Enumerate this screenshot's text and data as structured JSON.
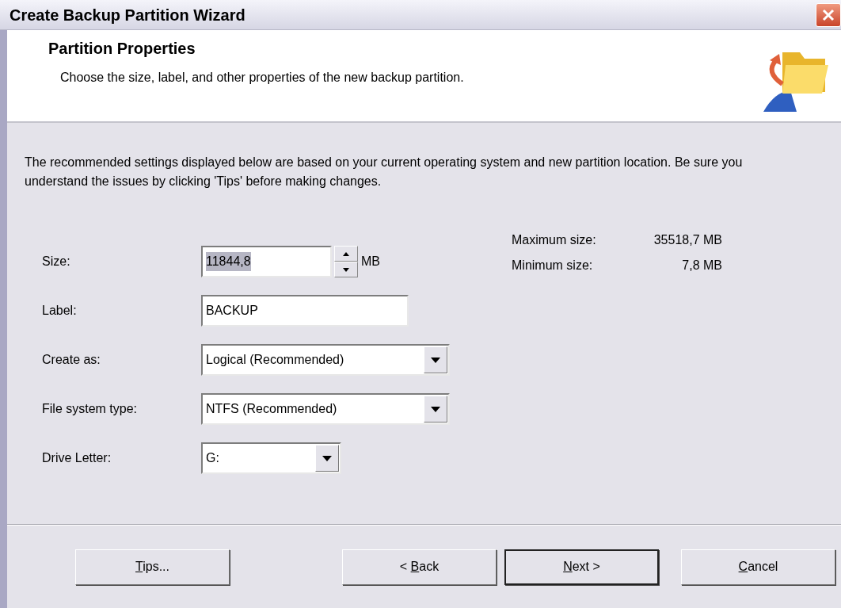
{
  "window": {
    "title": "Create Backup Partition Wizard"
  },
  "header": {
    "title": "Partition Properties",
    "subtitle": "Choose the size, label, and other properties of the new backup partition."
  },
  "intro": "The recommended settings displayed below are based on your current operating system and new partition location. Be sure you understand the issues by clicking 'Tips' before making changes.",
  "fields": [
    {
      "kind": "spin",
      "label": "Size:",
      "value": "11844,8",
      "text_selected": true,
      "unit": "MB"
    },
    {
      "kind": "text",
      "label": "Label:",
      "value": "BACKUP",
      "text_selected": false
    },
    {
      "kind": "combo",
      "label": "Create as:",
      "value": "Logical (Recommended)"
    },
    {
      "kind": "combo",
      "label": "File system type:",
      "value": "NTFS (Recommended)"
    },
    {
      "kind": "combo_small",
      "label": "Drive Letter:",
      "value": "G:"
    }
  ],
  "limits": [
    {
      "label": "Maximum size:",
      "value": "35518,7 MB"
    },
    {
      "label": "Minimum size:",
      "value": "7,8 MB"
    }
  ],
  "buttons": [
    {
      "key": "T",
      "after": "ips...",
      "default": false
    },
    {
      "before": "< ",
      "key": "B",
      "after": "ack",
      "default": false
    },
    {
      "key": "N",
      "after": "ext >",
      "default": true
    },
    {
      "key": "C",
      "after": "ancel",
      "default": false
    }
  ]
}
